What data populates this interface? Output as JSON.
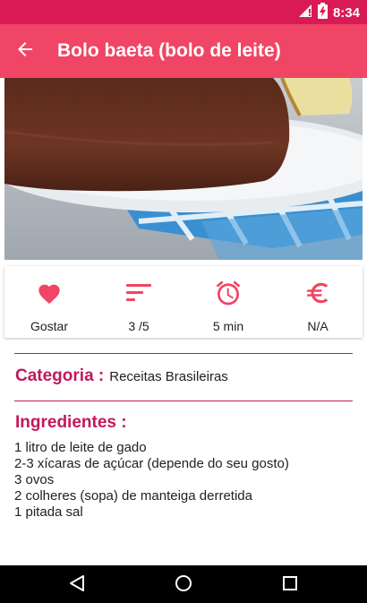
{
  "status_bar": {
    "time": "8:34",
    "icons": [
      "signal-icon",
      "battery-charging-icon"
    ]
  },
  "app_bar": {
    "title": "Bolo baeta (bolo de leite)",
    "back_icon": "arrow-back-icon",
    "color": "#f04564"
  },
  "hero_image": {
    "description_icon": "cake-photo"
  },
  "stats": [
    {
      "icon": "heart-icon",
      "label": "Gostar"
    },
    {
      "icon": "sort-icon",
      "label": "3 /5"
    },
    {
      "icon": "alarm-icon",
      "label": "5 min"
    },
    {
      "icon": "euro-icon",
      "label": "N/A"
    }
  ],
  "category": {
    "heading": "Categoria :",
    "value": "Receitas Brasileiras"
  },
  "ingredients": {
    "heading": "Ingredientes :",
    "items": [
      "1 litro de leite de gado",
      "2-3 xícaras de açúcar (depende do seu gosto)",
      "3 ovos",
      "2 colheres (sopa) de manteiga derretida",
      "1 pitada sal"
    ]
  },
  "nav_bar": {
    "buttons": [
      "back-triangle-icon",
      "home-circle-icon",
      "recents-square-icon"
    ]
  },
  "colors": {
    "status_bar": "#d81b55",
    "accent": "#f04564",
    "heading": "#c2185b"
  }
}
